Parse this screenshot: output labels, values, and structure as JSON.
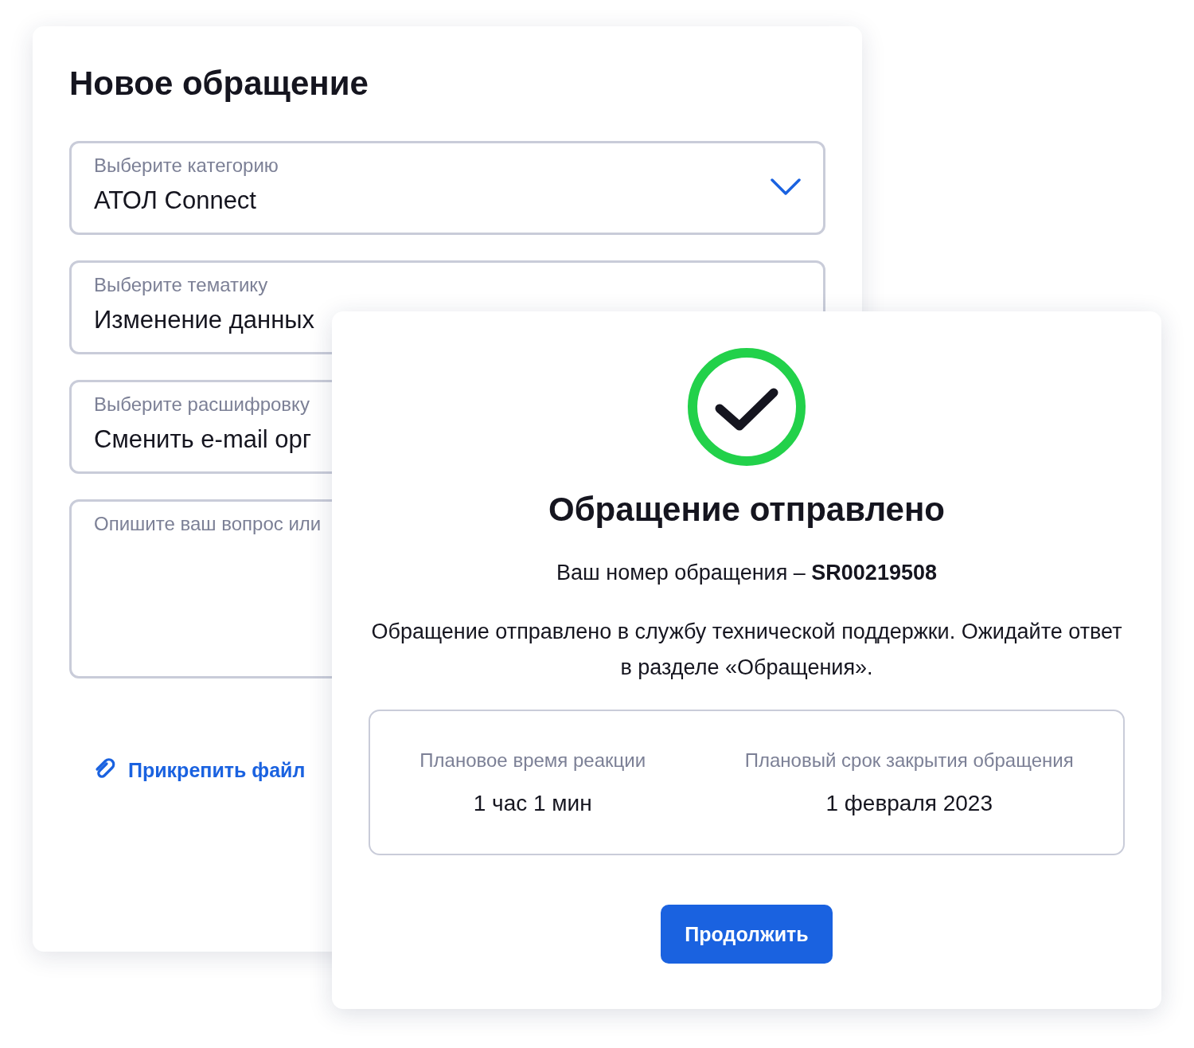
{
  "form": {
    "title": "Новое обращение",
    "fields": [
      {
        "kind": "dropdown",
        "label": "Выберите категорию",
        "value": "АТОЛ Connect"
      },
      {
        "kind": "field",
        "label": "Выберите тематику",
        "value": "Изменение данных"
      },
      {
        "kind": "field",
        "label": "Выберите расшифровку",
        "value": "Сменить e-mail орг"
      },
      {
        "kind": "textarea",
        "placeholder": "Опишите ваш вопрос или"
      }
    ],
    "attach_link": "Прикрепить файл"
  },
  "dialog": {
    "title": "Обращение отправлено",
    "number_line": "Ваш номер обращения – **SR00219508**",
    "message": "Обращение отправлено в службу технической поддержки. Ожидайте ответ в разделе «Обращения».",
    "info": [
      {
        "label": "Плановое время реакции",
        "value": "1 час 1 мин"
      },
      {
        "label": "Плановый срок закрытия обращения",
        "value": "1 февраля 2023"
      }
    ],
    "button": "Продолжить"
  }
}
